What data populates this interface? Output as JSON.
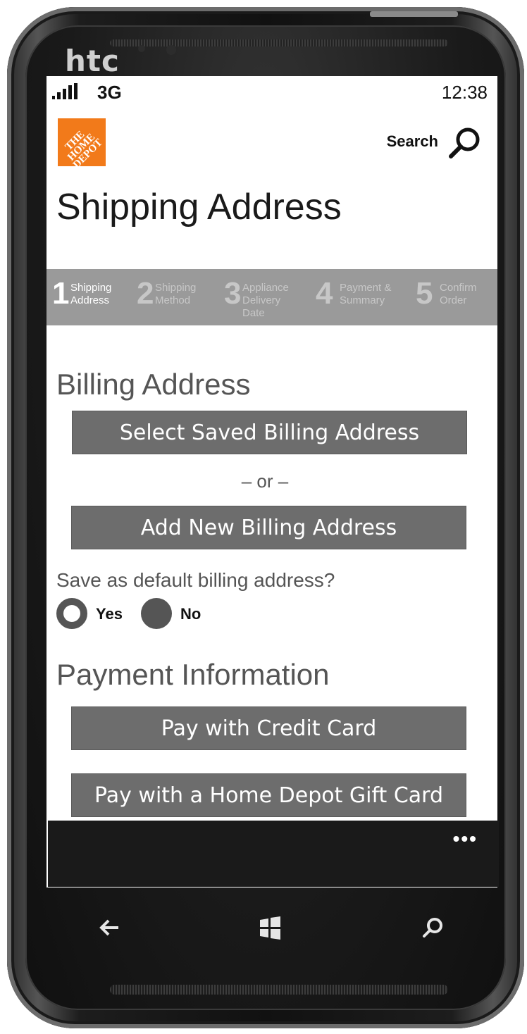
{
  "device": {
    "brand": "htc"
  },
  "status_bar": {
    "network": "3G",
    "time": "12:38"
  },
  "header": {
    "logo_text": "THE HOME DEPOT",
    "search_label": "Search"
  },
  "page": {
    "title": "Shipping Address"
  },
  "steps": [
    {
      "number": "1",
      "label": "Shipping Address",
      "active": true
    },
    {
      "number": "2",
      "label": "Shipping Method",
      "active": false
    },
    {
      "number": "3",
      "label": "Appliance Delivery Date",
      "active": false
    },
    {
      "number": "4",
      "label": "Payment & Summary",
      "active": false
    },
    {
      "number": "5",
      "label": "Confirm Order",
      "active": false
    }
  ],
  "billing": {
    "title": "Billing Address",
    "select_saved_label": "Select Saved Billing Address",
    "or_text": "– or –",
    "add_new_label": "Add New Billing Address",
    "save_default_question": "Save as default billing address?",
    "yes_label": "Yes",
    "no_label": "No"
  },
  "payment": {
    "title": "Payment Information",
    "credit_card_label": "Pay with Credit Card",
    "gift_card_label": "Pay with a Home Depot Gift Card"
  },
  "app_bar": {
    "more_icon": "ellipsis-icon"
  },
  "hardware_keys": {
    "back": "back-arrow-icon",
    "start": "windows-logo-icon",
    "search": "search-icon"
  }
}
